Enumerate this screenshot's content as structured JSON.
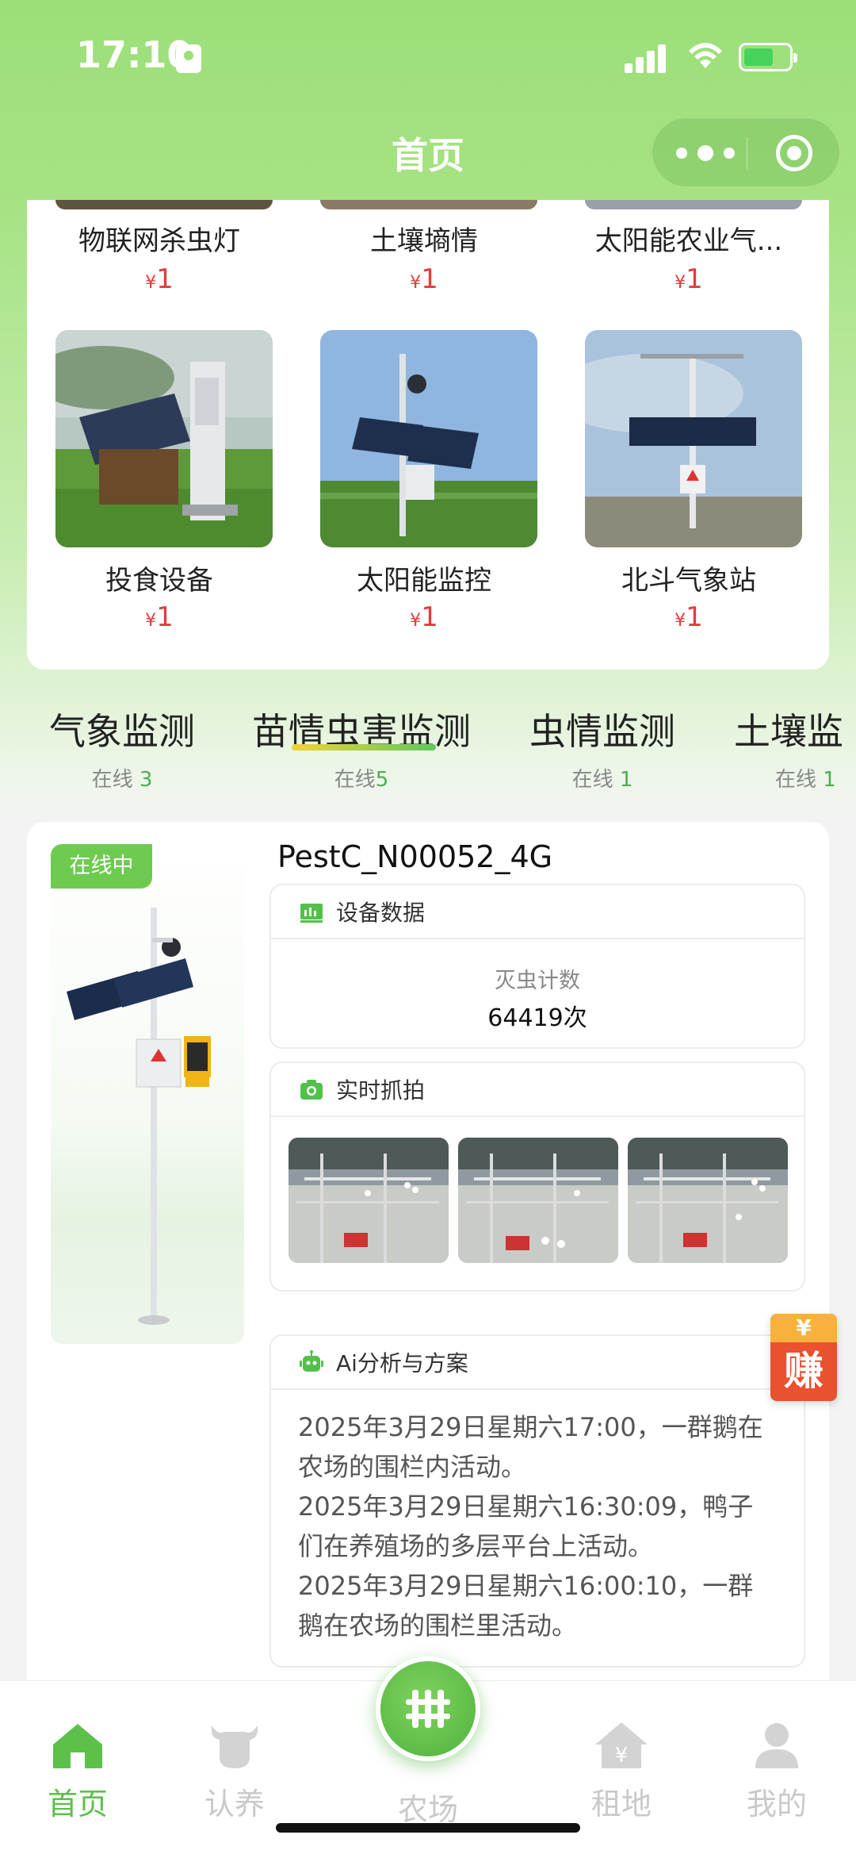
{
  "status_bar": {
    "time": "17:10"
  },
  "nav": {
    "title": "首页"
  },
  "products": {
    "row_top": [
      {
        "name": "物联网杀虫灯",
        "currency": "¥",
        "price": "1"
      },
      {
        "name": "土壤墒情",
        "currency": "¥",
        "price": "1"
      },
      {
        "name": "太阳能农业气...",
        "currency": "¥",
        "price": "1"
      }
    ],
    "row_bottom": [
      {
        "name": "投食设备",
        "currency": "¥",
        "price": "1"
      },
      {
        "name": "太阳能监控",
        "currency": "¥",
        "price": "1"
      },
      {
        "name": "北斗气象站",
        "currency": "¥",
        "price": "1"
      }
    ]
  },
  "categories": [
    {
      "label": "气象监测",
      "status": "在线",
      "count": "3",
      "active": false
    },
    {
      "label": "苗情虫害监测",
      "status": "在线",
      "count": "5",
      "active": true
    },
    {
      "label": "虫情监测",
      "status": "在线",
      "count": "1",
      "active": false
    },
    {
      "label": "土壤监",
      "status": "在线",
      "count": "1",
      "active": false
    }
  ],
  "device": {
    "online_badge": "在线中",
    "id": "PestC_N00052_4G",
    "data_panel": {
      "title": "设备数据",
      "metric_label": "灭虫计数",
      "metric_value": "64419次"
    },
    "snapshot_panel": {
      "title": "实时抓拍"
    },
    "ai_panel": {
      "title": "Ai分析与方案",
      "lines": [
        "2025年3月29日星期六17:00，一群鹅在农场的围栏内活动。",
        "2025年3月29日星期六16:30:09，鸭子们在养殖场的多层平台上活动。",
        "2025年3月29日星期六16:00:10，一群鹅在农场的围栏里活动。"
      ]
    }
  },
  "earn": {
    "top": "¥",
    "label": "赚"
  },
  "tabbar": {
    "home": "首页",
    "adopt": "认养",
    "farm": "农场",
    "rent": "租地",
    "mine": "我的"
  },
  "colors": {
    "brand_green": "#9bdf78",
    "active_green": "#5cc04b",
    "price_red": "#e23c3c"
  }
}
